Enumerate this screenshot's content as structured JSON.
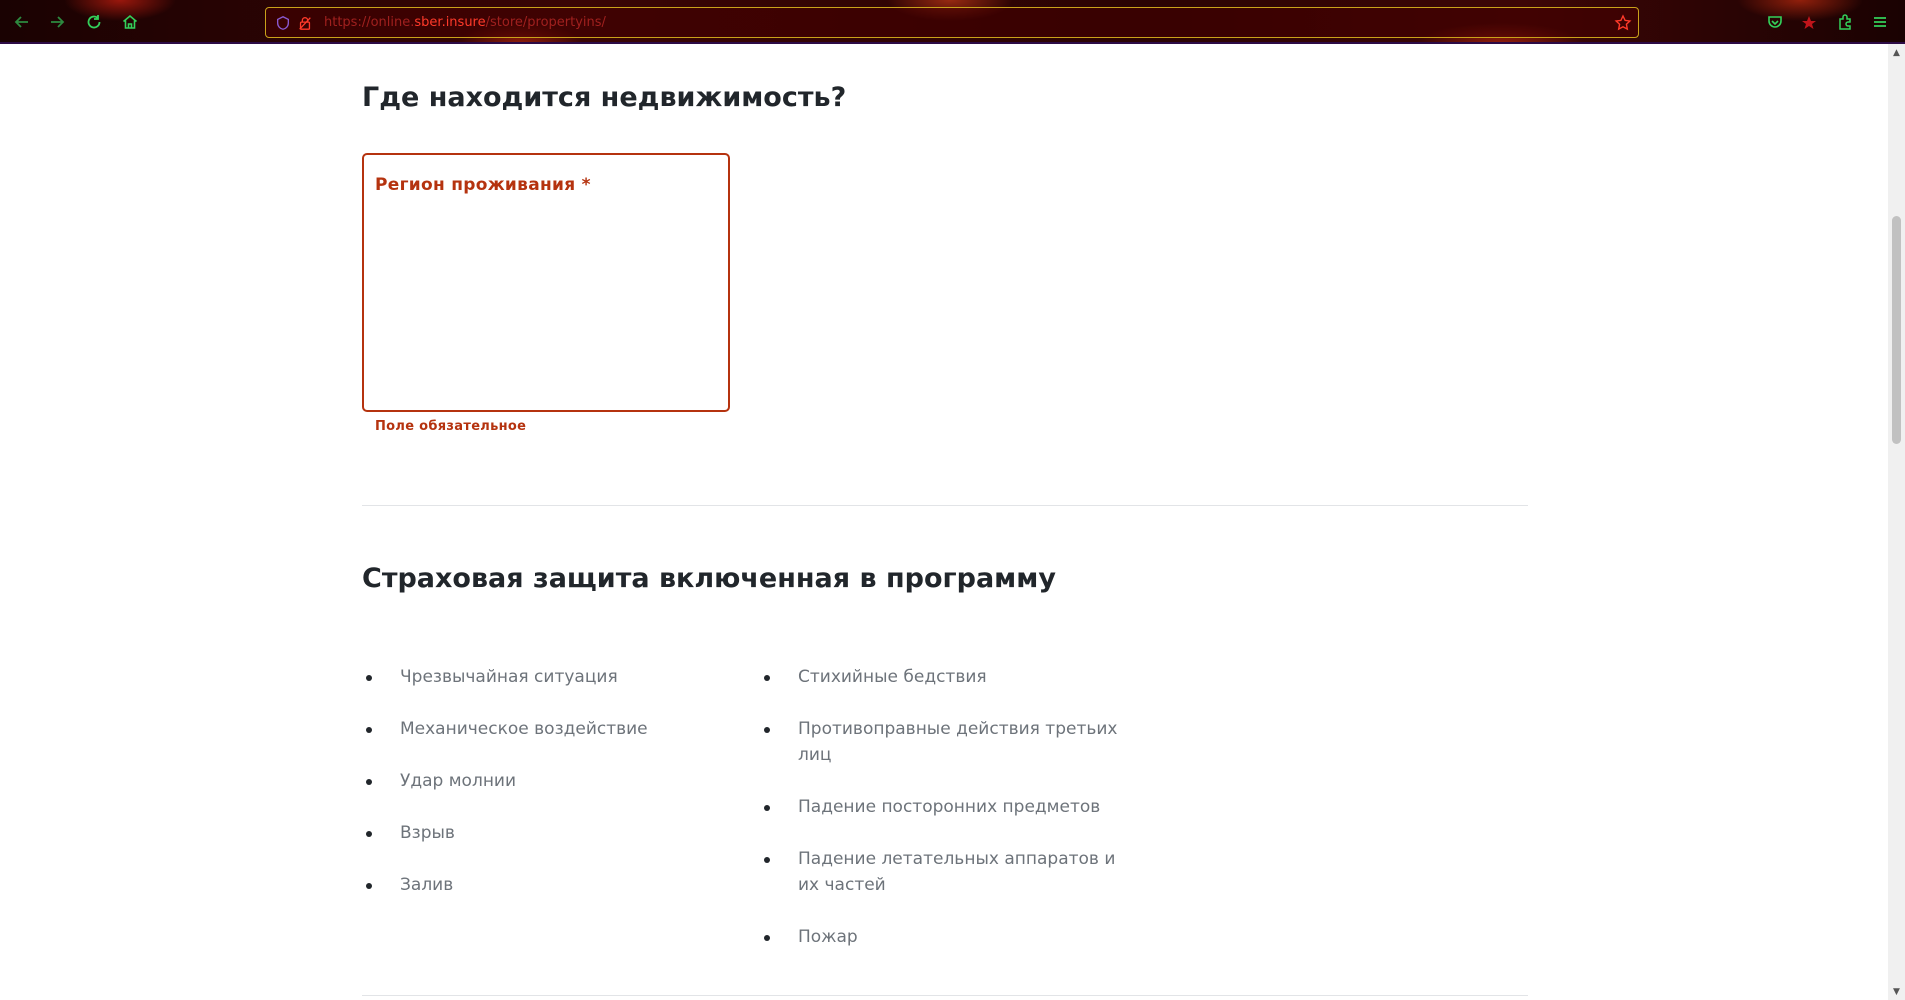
{
  "browser": {
    "url_prefix": "https://online.",
    "url_domain": "sber.insure",
    "url_suffix": "/store/propertyins/"
  },
  "page": {
    "location_heading": "Где находится недвижимость?",
    "region_field": {
      "label": "Регион проживания *",
      "error": "Поле обязательное"
    },
    "coverage_heading": "Страховая защита включенная в программу",
    "coverage_left": [
      "Чрезвычайная ситуация",
      "Механическое воздействие",
      "Удар молнии",
      "Взрыв",
      "Залив"
    ],
    "coverage_right": [
      "Стихийные бедствия",
      "Противоправные действия третьих лиц",
      "Падение посторонних предметов",
      "Падение летательных аппаратов и их частей",
      "Пожар"
    ]
  },
  "colors": {
    "heading": "#21262b",
    "error": "#b5330f",
    "list_text": "#6d737a",
    "toolbar_icon": "#33d15a"
  }
}
